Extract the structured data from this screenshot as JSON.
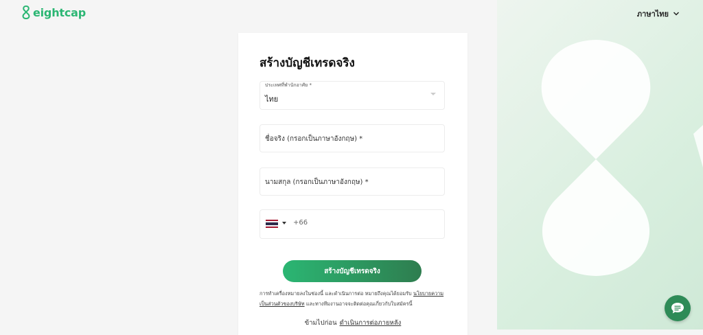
{
  "brand": {
    "name": "eightcap",
    "color": "#2bb673"
  },
  "header": {
    "language_label": "ภาษาไทย"
  },
  "form": {
    "title": "สร้างบัญชีเทรดจริง",
    "country": {
      "label": "ประเทศที่พำนักอาศัย *",
      "value": "ไทย"
    },
    "first_name": {
      "placeholder": "ชื่อจริง (กรอกเป็นภาษาอังกฤษ) *"
    },
    "last_name": {
      "placeholder": "นามสกุล (กรอกเป็นภาษาอังกฤษ) *"
    },
    "phone": {
      "country_code": "+66",
      "flag": "thailand-flag-icon"
    },
    "submit_label": "สร้างบัญชีเทรดจริง",
    "legal": {
      "text1": "การทำเครื่องหมายลงในช่องนี้ และดำเนินการต่อ หมายถึงคุณได้ยอมรับ ",
      "link": "นโยบายความเป็นส่วนตัวของบริษัท",
      "text2": " และทางทีมงานอาจจะติดต่อคุณเกี่ยวกับใบสมัครนี้"
    },
    "skip": {
      "text": "ข้ามไปก่อน",
      "link": "ดำเนินการต่อภายหลัง"
    }
  },
  "chat": {
    "icon": "chat-bubble-icon",
    "color": "#2e8b57"
  }
}
